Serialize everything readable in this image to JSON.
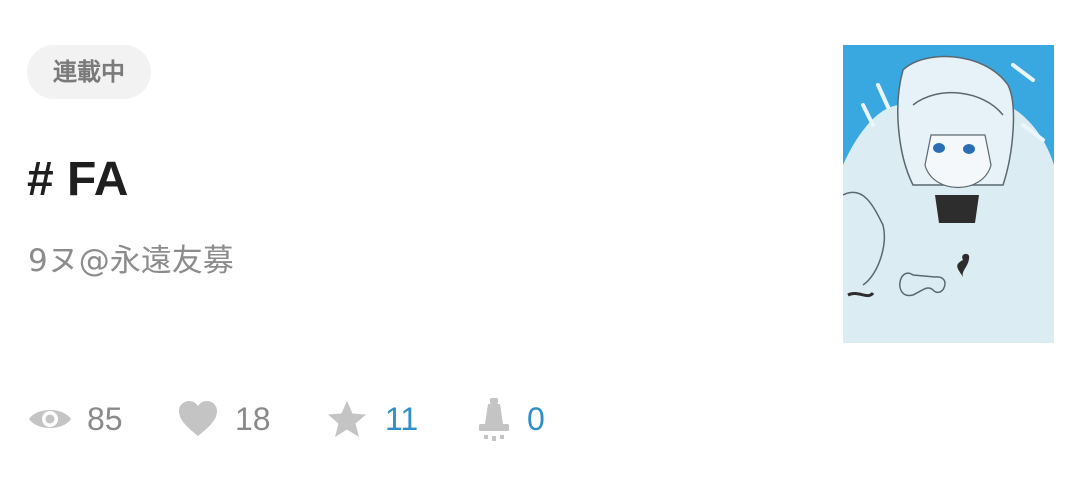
{
  "work": {
    "status": "連載中",
    "title": "# FA",
    "author": "9ヌ@永遠友募"
  },
  "stats": {
    "views": "85",
    "likes": "18",
    "bookmarks": "11",
    "alerts": "0"
  },
  "icons": {
    "views": "eye-icon",
    "likes": "heart-icon",
    "bookmarks": "star-icon",
    "alerts": "bell-icon"
  },
  "colors": {
    "badge_bg": "#f2f2f2",
    "badge_text": "#7a7a7a",
    "title": "#1f1f1f",
    "muted": "#8a8a8a",
    "accent": "#2f8fc6",
    "icon_gray": "#c4c4c4",
    "cover_bg": "#3aa8e0"
  }
}
